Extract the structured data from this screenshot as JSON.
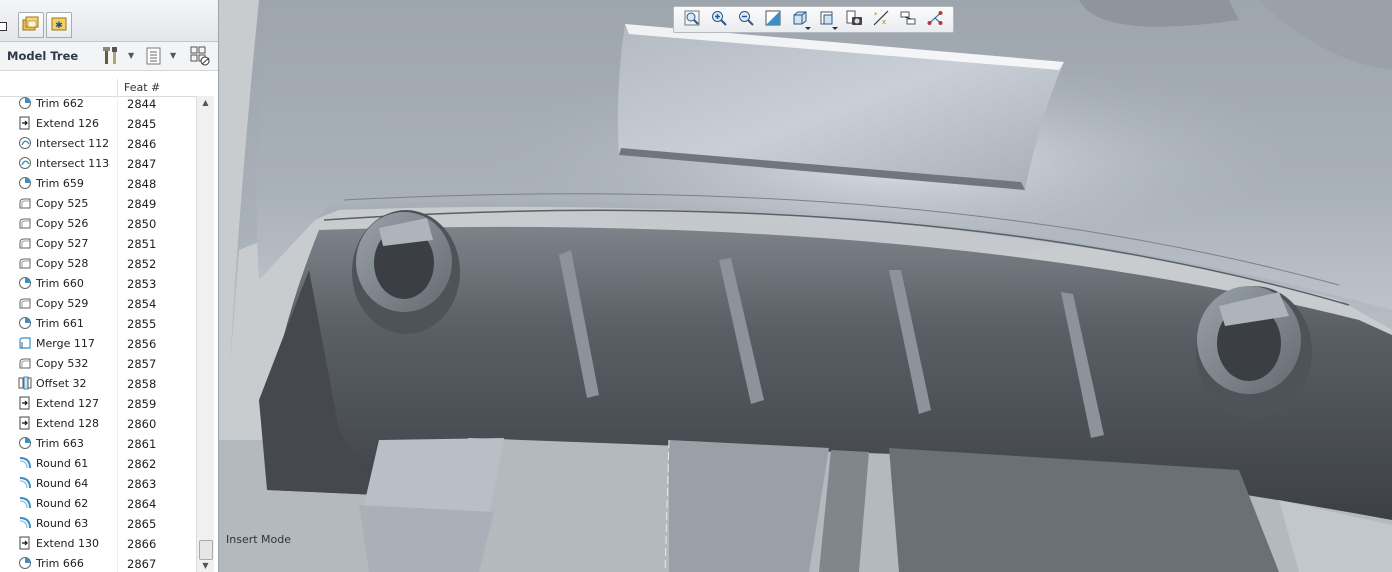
{
  "panel": {
    "tabs": [
      {
        "icon": "folder-browser-icon"
      },
      {
        "icon": "favorites-icon"
      }
    ]
  },
  "model_tree": {
    "title": "Model Tree",
    "header_icons": [
      "settings-tools-icon",
      "show-columns-icon",
      "filter-display-icon"
    ],
    "column_header": "Feat #",
    "rows": [
      {
        "name": "Trim 662",
        "num": "2844",
        "icon": "trim-icon"
      },
      {
        "name": "Extend 126",
        "num": "2845",
        "icon": "extend-icon"
      },
      {
        "name": "Intersect 112",
        "num": "2846",
        "icon": "intersect-icon"
      },
      {
        "name": "Intersect 113",
        "num": "2847",
        "icon": "intersect-icon"
      },
      {
        "name": "Trim 659",
        "num": "2848",
        "icon": "trim-icon"
      },
      {
        "name": "Copy 525",
        "num": "2849",
        "icon": "copy-icon"
      },
      {
        "name": "Copy 526",
        "num": "2850",
        "icon": "copy-icon"
      },
      {
        "name": "Copy 527",
        "num": "2851",
        "icon": "copy-icon"
      },
      {
        "name": "Copy 528",
        "num": "2852",
        "icon": "copy-icon"
      },
      {
        "name": "Trim 660",
        "num": "2853",
        "icon": "trim-icon"
      },
      {
        "name": "Copy 529",
        "num": "2854",
        "icon": "copy-icon"
      },
      {
        "name": "Trim 661",
        "num": "2855",
        "icon": "trim-icon"
      },
      {
        "name": "Merge 117",
        "num": "2856",
        "icon": "merge-icon"
      },
      {
        "name": "Copy 532",
        "num": "2857",
        "icon": "copy-icon"
      },
      {
        "name": "Offset 32",
        "num": "2858",
        "icon": "offset-icon"
      },
      {
        "name": "Extend 127",
        "num": "2859",
        "icon": "extend-icon"
      },
      {
        "name": "Extend 128",
        "num": "2860",
        "icon": "extend-icon"
      },
      {
        "name": "Trim 663",
        "num": "2861",
        "icon": "trim-icon"
      },
      {
        "name": "Round 61",
        "num": "2862",
        "icon": "round-icon"
      },
      {
        "name": "Round 64",
        "num": "2863",
        "icon": "round-icon"
      },
      {
        "name": "Round 62",
        "num": "2864",
        "icon": "round-icon"
      },
      {
        "name": "Round 63",
        "num": "2865",
        "icon": "round-icon"
      },
      {
        "name": "Extend 130",
        "num": "2866",
        "icon": "extend-icon"
      },
      {
        "name": "Trim 666",
        "num": "2867",
        "icon": "trim-icon"
      }
    ]
  },
  "view_toolbar": [
    {
      "name": "refit-icon"
    },
    {
      "name": "zoom-in-icon"
    },
    {
      "name": "zoom-out-icon"
    },
    {
      "name": "repaint-icon"
    },
    {
      "name": "display-style-icon"
    },
    {
      "name": "saved-views-icon"
    },
    {
      "name": "view-manager-icon"
    },
    {
      "name": "datum-display-icon"
    },
    {
      "name": "spin-center-icon"
    },
    {
      "name": "annotation-display-icon"
    }
  ],
  "viewport": {
    "mode_label": "Insert Mode"
  },
  "colors": {
    "tree_icon_blue": "#3a8fc4",
    "surface_light": "#b8bec5",
    "surface_dark": "#3f4348"
  }
}
